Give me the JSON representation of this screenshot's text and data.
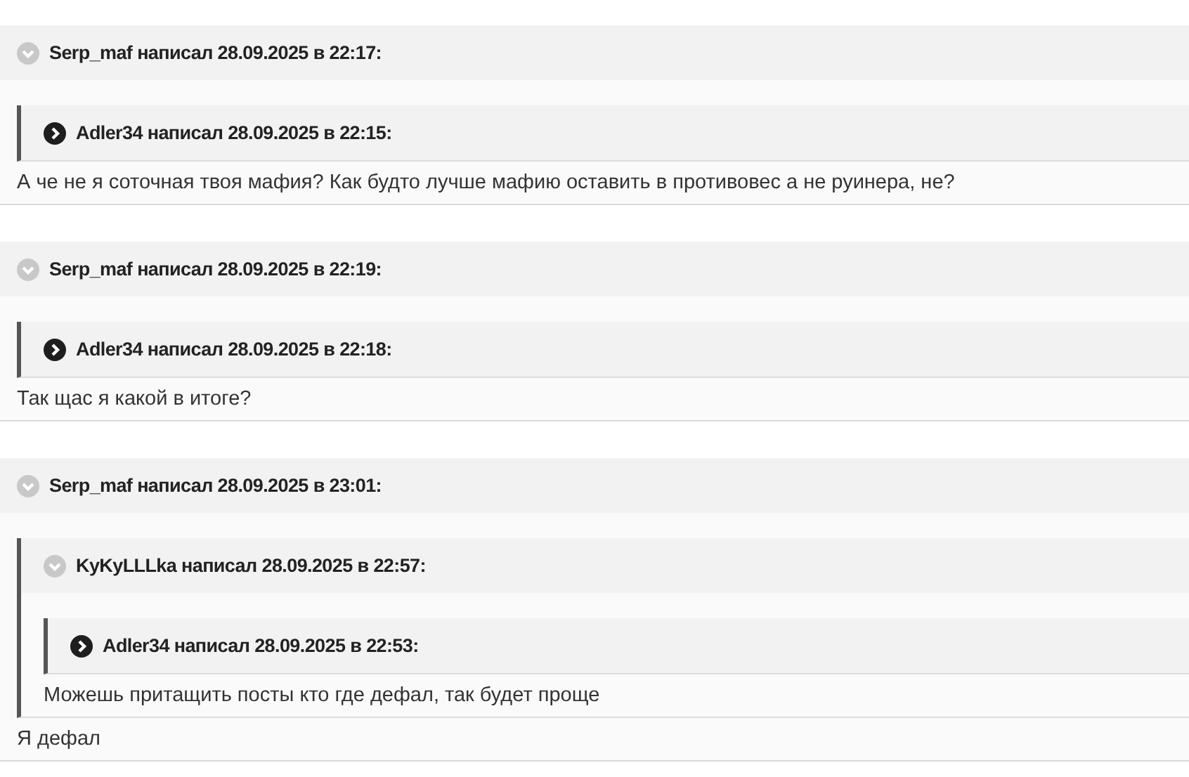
{
  "posts": [
    {
      "header": "Serp_maf написал 28.09.2025 в 22:17:",
      "expanded": true,
      "quote": {
        "header": "Adler34 написал 28.09.2025 в 22:15:",
        "expanded": false
      },
      "text": "А че не я соточная твоя мафия? Как будто лучше мафию оставить в противовес а не руинера, не?"
    },
    {
      "header": "Serp_maf написал 28.09.2025 в 22:19:",
      "expanded": true,
      "quote": {
        "header": "Adler34 написал 28.09.2025 в 22:18:",
        "expanded": false
      },
      "text": "Так щас я какой в итоге?"
    },
    {
      "header": "Serp_maf написал 28.09.2025 в 23:01:",
      "expanded": true,
      "quote": {
        "header": "KyKyLLLka написал 28.09.2025 в 22:57:",
        "expanded": true,
        "quote": {
          "header": "Adler34 написал 28.09.2025 в 22:53:",
          "expanded": false
        },
        "text": "Можешь притащить посты кто где дефал, так будет проще"
      },
      "text": "Я дефал"
    }
  ]
}
